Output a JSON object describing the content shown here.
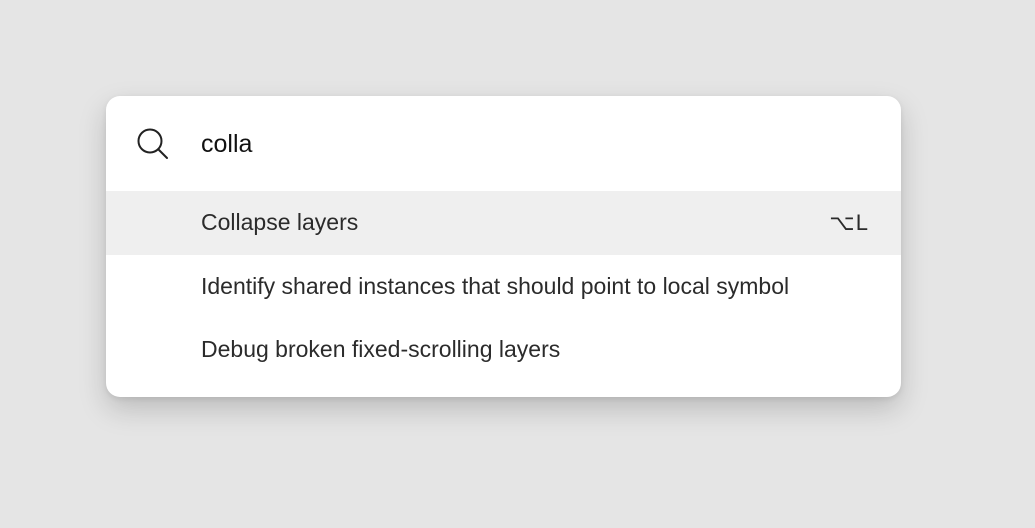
{
  "palette": {
    "search": {
      "icon": "search-icon",
      "value": "colla",
      "placeholder": ""
    },
    "results": [
      {
        "label": "Collapse layers",
        "shortcut": "⌥L",
        "selected": true
      },
      {
        "label": "Identify shared instances that should point to local symbol",
        "shortcut": "",
        "selected": false
      },
      {
        "label": "Debug broken fixed-scrolling layers",
        "shortcut": "",
        "selected": false
      }
    ]
  },
  "colors": {
    "background": "#e5e5e5",
    "panel": "#ffffff",
    "selected_row": "#efefef",
    "text": "#2b2b2b"
  }
}
